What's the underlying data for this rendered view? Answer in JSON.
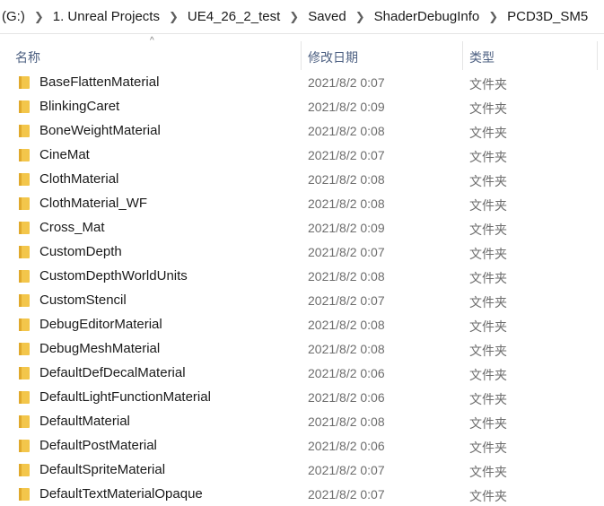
{
  "breadcrumb": [
    "(G:)",
    "1. Unreal Projects",
    "UE4_26_2_test",
    "Saved",
    "ShaderDebugInfo",
    "PCD3D_SM5"
  ],
  "columns": {
    "name": "名称",
    "date": "修改日期",
    "type": "类型"
  },
  "sort_indicator": "^",
  "rows": [
    {
      "name": "BaseFlattenMaterial",
      "date": "2021/8/2 0:07",
      "type": "文件夹"
    },
    {
      "name": "BlinkingCaret",
      "date": "2021/8/2 0:09",
      "type": "文件夹"
    },
    {
      "name": "BoneWeightMaterial",
      "date": "2021/8/2 0:08",
      "type": "文件夹"
    },
    {
      "name": "CineMat",
      "date": "2021/8/2 0:07",
      "type": "文件夹"
    },
    {
      "name": "ClothMaterial",
      "date": "2021/8/2 0:08",
      "type": "文件夹"
    },
    {
      "name": "ClothMaterial_WF",
      "date": "2021/8/2 0:08",
      "type": "文件夹"
    },
    {
      "name": "Cross_Mat",
      "date": "2021/8/2 0:09",
      "type": "文件夹"
    },
    {
      "name": "CustomDepth",
      "date": "2021/8/2 0:07",
      "type": "文件夹"
    },
    {
      "name": "CustomDepthWorldUnits",
      "date": "2021/8/2 0:08",
      "type": "文件夹"
    },
    {
      "name": "CustomStencil",
      "date": "2021/8/2 0:07",
      "type": "文件夹"
    },
    {
      "name": "DebugEditorMaterial",
      "date": "2021/8/2 0:08",
      "type": "文件夹"
    },
    {
      "name": "DebugMeshMaterial",
      "date": "2021/8/2 0:08",
      "type": "文件夹"
    },
    {
      "name": "DefaultDefDecalMaterial",
      "date": "2021/8/2 0:06",
      "type": "文件夹"
    },
    {
      "name": "DefaultLightFunctionMaterial",
      "date": "2021/8/2 0:06",
      "type": "文件夹"
    },
    {
      "name": "DefaultMaterial",
      "date": "2021/8/2 0:08",
      "type": "文件夹"
    },
    {
      "name": "DefaultPostMaterial",
      "date": "2021/8/2 0:06",
      "type": "文件夹"
    },
    {
      "name": "DefaultSpriteMaterial",
      "date": "2021/8/2 0:07",
      "type": "文件夹"
    },
    {
      "name": "DefaultTextMaterialOpaque",
      "date": "2021/8/2 0:07",
      "type": "文件夹"
    }
  ]
}
